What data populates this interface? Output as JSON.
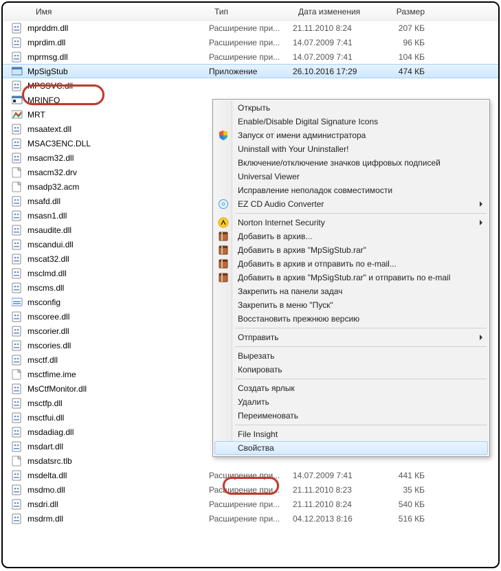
{
  "columns": {
    "name": "Имя",
    "type": "Тип",
    "date": "Дата изменения",
    "size": "Размер"
  },
  "files": [
    {
      "icon": "dll",
      "name": "mprddm.dll",
      "type": "Расширение при...",
      "date": "21.11.2010 8:24",
      "size": "207 КБ"
    },
    {
      "icon": "dll",
      "name": "mprdim.dll",
      "type": "Расширение при...",
      "date": "14.07.2009 7:41",
      "size": "96 КБ"
    },
    {
      "icon": "dll",
      "name": "mprmsg.dll",
      "type": "Расширение при...",
      "date": "14.07.2009 7:41",
      "size": "104 КБ"
    },
    {
      "icon": "exe",
      "name": "MpSigStub",
      "type": "Приложение",
      "date": "26.10.2016 17:29",
      "size": "474 КБ",
      "selected": true
    },
    {
      "icon": "dll",
      "name": "MPSSVC.dll",
      "type": "",
      "date": "",
      "size": ""
    },
    {
      "icon": "exe2",
      "name": "MRINFO",
      "type": "",
      "date": "",
      "size": ""
    },
    {
      "icon": "mrt",
      "name": "MRT",
      "type": "",
      "date": "",
      "size": ""
    },
    {
      "icon": "dll",
      "name": "msaatext.dll",
      "type": "",
      "date": "",
      "size": ""
    },
    {
      "icon": "dll",
      "name": "MSAC3ENC.DLL",
      "type": "",
      "date": "",
      "size": ""
    },
    {
      "icon": "dll",
      "name": "msacm32.dll",
      "type": "",
      "date": "",
      "size": ""
    },
    {
      "icon": "file",
      "name": "msacm32.drv",
      "type": "",
      "date": "",
      "size": ""
    },
    {
      "icon": "file",
      "name": "msadp32.acm",
      "type": "",
      "date": "",
      "size": ""
    },
    {
      "icon": "dll",
      "name": "msafd.dll",
      "type": "",
      "date": "",
      "size": ""
    },
    {
      "icon": "dll",
      "name": "msasn1.dll",
      "type": "",
      "date": "",
      "size": ""
    },
    {
      "icon": "dll",
      "name": "msaudite.dll",
      "type": "",
      "date": "",
      "size": ""
    },
    {
      "icon": "dll",
      "name": "mscandui.dll",
      "type": "",
      "date": "",
      "size": ""
    },
    {
      "icon": "dll",
      "name": "mscat32.dll",
      "type": "",
      "date": "",
      "size": ""
    },
    {
      "icon": "dll",
      "name": "msclmd.dll",
      "type": "",
      "date": "",
      "size": ""
    },
    {
      "icon": "dll",
      "name": "mscms.dll",
      "type": "",
      "date": "",
      "size": ""
    },
    {
      "icon": "exe3",
      "name": "msconfig",
      "type": "",
      "date": "",
      "size": ""
    },
    {
      "icon": "dll",
      "name": "mscoree.dll",
      "type": "",
      "date": "",
      "size": ""
    },
    {
      "icon": "dll",
      "name": "mscorier.dll",
      "type": "",
      "date": "",
      "size": ""
    },
    {
      "icon": "dll",
      "name": "mscories.dll",
      "type": "",
      "date": "",
      "size": ""
    },
    {
      "icon": "dll",
      "name": "msctf.dll",
      "type": "",
      "date": "",
      "size": ""
    },
    {
      "icon": "file",
      "name": "msctfime.ime",
      "type": "",
      "date": "",
      "size": ""
    },
    {
      "icon": "dll",
      "name": "MsCtfMonitor.dll",
      "type": "",
      "date": "",
      "size": ""
    },
    {
      "icon": "dll",
      "name": "msctfp.dll",
      "type": "",
      "date": "",
      "size": ""
    },
    {
      "icon": "dll",
      "name": "msctfui.dll",
      "type": "",
      "date": "",
      "size": ""
    },
    {
      "icon": "dll",
      "name": "msdadiag.dll",
      "type": "",
      "date": "",
      "size": ""
    },
    {
      "icon": "dll",
      "name": "msdart.dll",
      "type": "",
      "date": "",
      "size": ""
    },
    {
      "icon": "file",
      "name": "msdatsrc.tlb",
      "type": "",
      "date": "",
      "size": ""
    },
    {
      "icon": "dll",
      "name": "msdelta.dll",
      "type": "Расширение при...",
      "date": "14.07.2009 7:41",
      "size": "441 КБ"
    },
    {
      "icon": "dll",
      "name": "msdmo.dll",
      "type": "Расширение при...",
      "date": "21.11.2010 8:23",
      "size": "35 КБ"
    },
    {
      "icon": "dll",
      "name": "msdri.dll",
      "type": "Расширение при...",
      "date": "21.11.2010 8:24",
      "size": "540 КБ"
    },
    {
      "icon": "dll",
      "name": "msdrm.dll",
      "type": "Расширение при...",
      "date": "04.12.2013 8:16",
      "size": "516 КБ"
    }
  ],
  "menu": [
    {
      "kind": "item",
      "label": "Открыть"
    },
    {
      "kind": "item",
      "label": "Enable/Disable Digital Signature Icons"
    },
    {
      "kind": "item",
      "label": "Запуск от имени администратора",
      "icon": "shield"
    },
    {
      "kind": "item",
      "label": "Uninstall with Your Uninstaller!"
    },
    {
      "kind": "item",
      "label": "Включение/отключение значков цифровых подписей"
    },
    {
      "kind": "item",
      "label": "Universal Viewer"
    },
    {
      "kind": "item",
      "label": "Исправление неполадок совместимости"
    },
    {
      "kind": "item",
      "label": "EZ CD Audio Converter",
      "icon": "disc",
      "submenu": true
    },
    {
      "kind": "sep"
    },
    {
      "kind": "item",
      "label": "Norton Internet Security",
      "icon": "norton",
      "submenu": true
    },
    {
      "kind": "item",
      "label": "Добавить в архив...",
      "icon": "rar"
    },
    {
      "kind": "item",
      "label": "Добавить в архив \"MpSigStub.rar\"",
      "icon": "rar"
    },
    {
      "kind": "item",
      "label": "Добавить в архив и отправить по e-mail...",
      "icon": "rar"
    },
    {
      "kind": "item",
      "label": "Добавить в архив \"MpSigStub.rar\" и отправить по e-mail",
      "icon": "rar"
    },
    {
      "kind": "item",
      "label": "Закрепить на панели задач"
    },
    {
      "kind": "item",
      "label": "Закрепить в меню \"Пуск\""
    },
    {
      "kind": "item",
      "label": "Восстановить прежнюю версию"
    },
    {
      "kind": "sep"
    },
    {
      "kind": "item",
      "label": "Отправить",
      "submenu": true
    },
    {
      "kind": "sep"
    },
    {
      "kind": "item",
      "label": "Вырезать"
    },
    {
      "kind": "item",
      "label": "Копировать"
    },
    {
      "kind": "sep"
    },
    {
      "kind": "item",
      "label": "Создать ярлык"
    },
    {
      "kind": "item",
      "label": "Удалить"
    },
    {
      "kind": "item",
      "label": "Переименовать"
    },
    {
      "kind": "sep"
    },
    {
      "kind": "item",
      "label": "File Insight"
    },
    {
      "kind": "item",
      "label": "Свойства",
      "hovered": true
    }
  ]
}
